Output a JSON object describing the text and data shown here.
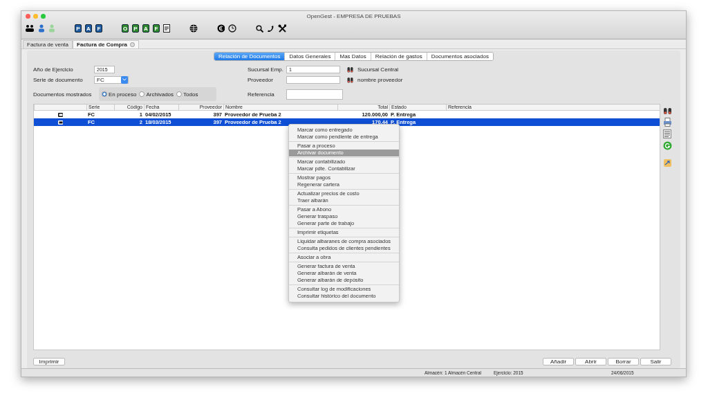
{
  "window": {
    "title": "OpenGest - EMPRESA DE PRUEBAS"
  },
  "toolbar": [
    [
      {
        "kind": "users"
      },
      {
        "kind": "person",
        "color": "#2a6fc9"
      },
      {
        "kind": "person",
        "color": "#9ad49a"
      }
    ],
    [
      {
        "kind": "badge",
        "label": "P",
        "color": "#1e5aa0"
      },
      {
        "kind": "badge",
        "label": "A",
        "color": "#1e5aa0"
      },
      {
        "kind": "badge",
        "label": "F",
        "color": "#1e5aa0"
      }
    ],
    [
      {
        "kind": "badge",
        "label": "O",
        "color": "#2f8a2f"
      },
      {
        "kind": "badge",
        "label": "P",
        "color": "#2f8a2f"
      },
      {
        "kind": "badge",
        "label": "A",
        "color": "#2f8a2f"
      },
      {
        "kind": "badge",
        "label": "F",
        "color": "#2f8a2f"
      },
      {
        "kind": "doc"
      }
    ],
    [
      {
        "kind": "globe"
      }
    ],
    [
      {
        "kind": "euro"
      },
      {
        "kind": "clock"
      }
    ],
    [
      {
        "kind": "search"
      },
      {
        "kind": "phone"
      },
      {
        "kind": "tools"
      }
    ]
  ],
  "doc_tabs": [
    {
      "label": "Factura de venta",
      "selected": false,
      "closable": false
    },
    {
      "label": "Factura de Compra",
      "selected": true,
      "closable": true
    }
  ],
  "section_tabs": [
    {
      "label": "Relación de Documentos",
      "selected": true
    },
    {
      "label": "Datos Generales",
      "selected": false
    },
    {
      "label": "Mas Datos",
      "selected": false
    },
    {
      "label": "Relación de gastos",
      "selected": false
    },
    {
      "label": "Documentos asociados",
      "selected": false
    }
  ],
  "form": {
    "year_label": "Año de Ejercicio",
    "year": "2015",
    "series_label": "Serie de documento",
    "series": "FC",
    "shown_label": "Documentos mostrados",
    "shown_options": [
      {
        "label": "En proceso",
        "selected": true
      },
      {
        "label": "Archivados",
        "selected": false
      },
      {
        "label": "Todos",
        "selected": false
      }
    ],
    "branch_label": "Sucursal Emp.",
    "branch": "1",
    "branch_name": "Sucursal Central",
    "supplier_label": "Proveedor",
    "supplier_name": "nombre proveedor",
    "reference_label": "Referencia"
  },
  "table": {
    "columns": [
      "Serie",
      "Código",
      "Fecha",
      "Proveedor",
      "Nombre",
      "Total",
      "Estado",
      "Referencia"
    ],
    "rows": [
      {
        "selected": false,
        "cells": [
          "FC",
          "1",
          "04/02/2015",
          "397",
          "Proveedor de Prueba 2",
          "120.000,00",
          "P. Entrega",
          ""
        ]
      },
      {
        "selected": true,
        "cells": [
          "FC",
          "2",
          "18/03/2015",
          "397",
          "Proveedor de Prueba 2",
          "170,44",
          "P. Entrega",
          ""
        ]
      }
    ]
  },
  "side_icons": [
    {
      "kind": "binoculars"
    },
    {
      "kind": "printer"
    },
    {
      "kind": "list"
    },
    {
      "kind": "refresh"
    },
    {
      "kind": "export"
    }
  ],
  "context_menu": [
    [
      {
        "label": "Marcar como entregado",
        "selected": false
      },
      {
        "label": "Marcar como pendiente de entrega",
        "selected": false
      }
    ],
    [
      {
        "label": "Pasar a proceso",
        "selected": false
      },
      {
        "label": "Archivar documento",
        "selected": true
      }
    ],
    [
      {
        "label": "Marcar contabilizado",
        "selected": false
      },
      {
        "label": "Marcar pdte. Contabilizar",
        "selected": false
      }
    ],
    [
      {
        "label": "Mostrar pagos",
        "selected": false
      },
      {
        "label": "Regenerar cartera",
        "selected": false
      }
    ],
    [
      {
        "label": "Actualizar precios de costo",
        "selected": false
      },
      {
        "label": "Traer albarán",
        "selected": false
      }
    ],
    [
      {
        "label": "Pasar a Abono",
        "selected": false
      },
      {
        "label": "Generar traspaso",
        "selected": false
      },
      {
        "label": "Generar parte de trabajo",
        "selected": false
      }
    ],
    [
      {
        "label": "Imprimir etiquetas",
        "selected": false
      }
    ],
    [
      {
        "label": "Liquidar albaranes de compra asociados",
        "selected": false
      },
      {
        "label": "Consulta pedidos de clientes pendientes",
        "selected": false
      }
    ],
    [
      {
        "label": "Asociar a obra",
        "selected": false
      }
    ],
    [
      {
        "label": "Generar factura de venta",
        "selected": false
      },
      {
        "label": "Generar albarán de venta",
        "selected": false
      },
      {
        "label": "Generar albarán de depósito",
        "selected": false
      }
    ],
    [
      {
        "label": "Consultar log de modificaciones",
        "selected": false
      },
      {
        "label": "Consultar histórico del documento",
        "selected": false
      }
    ]
  ],
  "left_buttons": [
    "Imprimir"
  ],
  "right_buttons": [
    "Añadir",
    "Abrir",
    "Borrar",
    "Salir"
  ],
  "status_bar": [
    "Almacén: 1 Almacén Central",
    "Ejercicio: 2015",
    "24/06/2015"
  ]
}
